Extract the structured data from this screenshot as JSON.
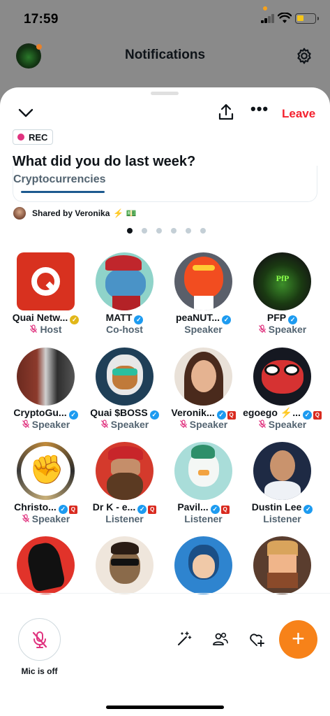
{
  "status": {
    "time": "17:59"
  },
  "header": {
    "title": "Notifications"
  },
  "space": {
    "leave_label": "Leave",
    "rec_label": "REC",
    "title": "What did you do last week?",
    "topic": "Cryptocurrencies",
    "shared_by": "Shared by Veronika",
    "shared_badges": "⚡ 💵",
    "pager": {
      "count": 6,
      "active": 0
    }
  },
  "participants": [
    {
      "name": "Quai Netw...",
      "role": "Host",
      "mic_muted": true,
      "badge": "gold",
      "avatar": "quai-logo"
    },
    {
      "name": "MATT",
      "role": "Co-host",
      "mic_muted": false,
      "badge": "blue",
      "avatar": "pepe-cap"
    },
    {
      "name": "peaNUT...",
      "role": "Speaker",
      "mic_muted": false,
      "badge": "blue",
      "avatar": "flame-face"
    },
    {
      "name": "PFP",
      "role": "Speaker",
      "mic_muted": true,
      "badge": "blue",
      "avatar": "pfp-green"
    },
    {
      "name": "CryptoGu...",
      "role": "Speaker",
      "mic_muted": true,
      "badge": "blue",
      "avatar": "crypto-gu"
    },
    {
      "name": "Quai $BOSS",
      "role": "Speaker",
      "mic_muted": true,
      "badge": "blue",
      "avatar": "astronaut"
    },
    {
      "name": "Veronik...",
      "role": "Speaker",
      "mic_muted": true,
      "badge": "blue",
      "avatar": "veronika"
    },
    {
      "name": "egoego ⚡...",
      "role": "Speaker",
      "mic_muted": true,
      "badge": "blue",
      "avatar": "pepe-red"
    },
    {
      "name": "Christo...",
      "role": "Speaker",
      "mic_muted": true,
      "badge": "blue",
      "avatar": "fist"
    },
    {
      "name": "Dr K - e...",
      "role": "Listener",
      "mic_muted": false,
      "badge": "blue",
      "avatar": "bearded"
    },
    {
      "name": "Pavil...",
      "role": "Listener",
      "mic_muted": false,
      "badge": "blue",
      "avatar": "penguin"
    },
    {
      "name": "Dustin Lee",
      "role": "Listener",
      "mic_muted": false,
      "badge": "blue",
      "avatar": "dustin"
    },
    {
      "name": "",
      "role": "",
      "mic_muted": false,
      "badge": "",
      "avatar": "red-anime"
    },
    {
      "name": "",
      "role": "",
      "mic_muted": false,
      "badge": "",
      "avatar": "sunglasses"
    },
    {
      "name": "",
      "role": "",
      "mic_muted": false,
      "badge": "",
      "avatar": "blue-anime"
    },
    {
      "name": "",
      "role": "",
      "mic_muted": false,
      "badge": "",
      "avatar": "pixel-chef"
    }
  ],
  "bottom": {
    "mic_label": "Mic is off"
  },
  "colors": {
    "accent": "#f78219",
    "leave": "#f4212e",
    "rec": "#e0337f",
    "verified": "#1d9bf0"
  }
}
